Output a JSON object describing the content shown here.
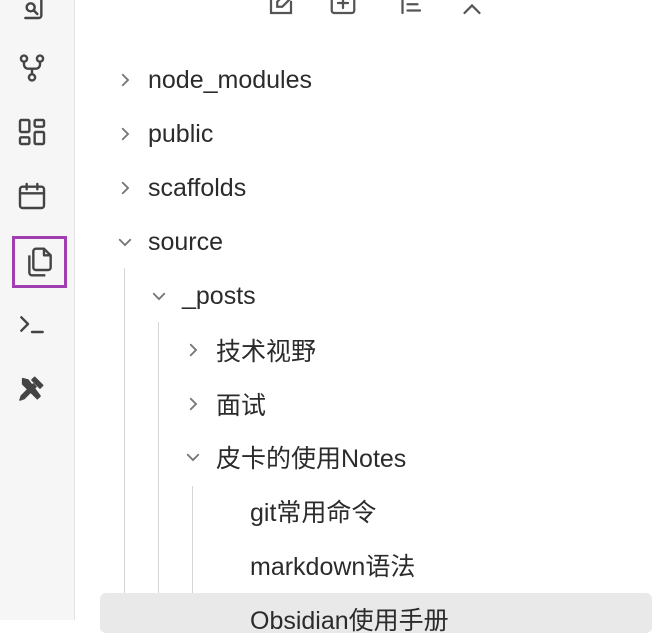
{
  "ribbon": {
    "icons": [
      {
        "name": "search-icon"
      },
      {
        "name": "graph-icon"
      },
      {
        "name": "canvas-icon"
      },
      {
        "name": "calendar-icon"
      },
      {
        "name": "files-icon",
        "active": true
      },
      {
        "name": "terminal-icon"
      },
      {
        "name": "tools-icon"
      }
    ],
    "active_color": "#a040b0"
  },
  "toolbar": {
    "buttons": [
      "new-note-icon",
      "new-folder-icon",
      "sort-icon",
      "collapse-icon"
    ]
  },
  "tree": {
    "items": [
      {
        "label": "node_modules",
        "expanded": false
      },
      {
        "label": "public",
        "expanded": false
      },
      {
        "label": "scaffolds",
        "expanded": false
      },
      {
        "label": "source",
        "expanded": true
      },
      {
        "label": "_posts",
        "expanded": true
      },
      {
        "label": "技术视野",
        "expanded": false
      },
      {
        "label": "面试",
        "expanded": false
      },
      {
        "label": "皮卡的使用Notes",
        "expanded": true
      },
      {
        "label": "git常用命令"
      },
      {
        "label": "markdown语法"
      },
      {
        "label": "Obsidian使用手册",
        "selected": true
      }
    ]
  }
}
